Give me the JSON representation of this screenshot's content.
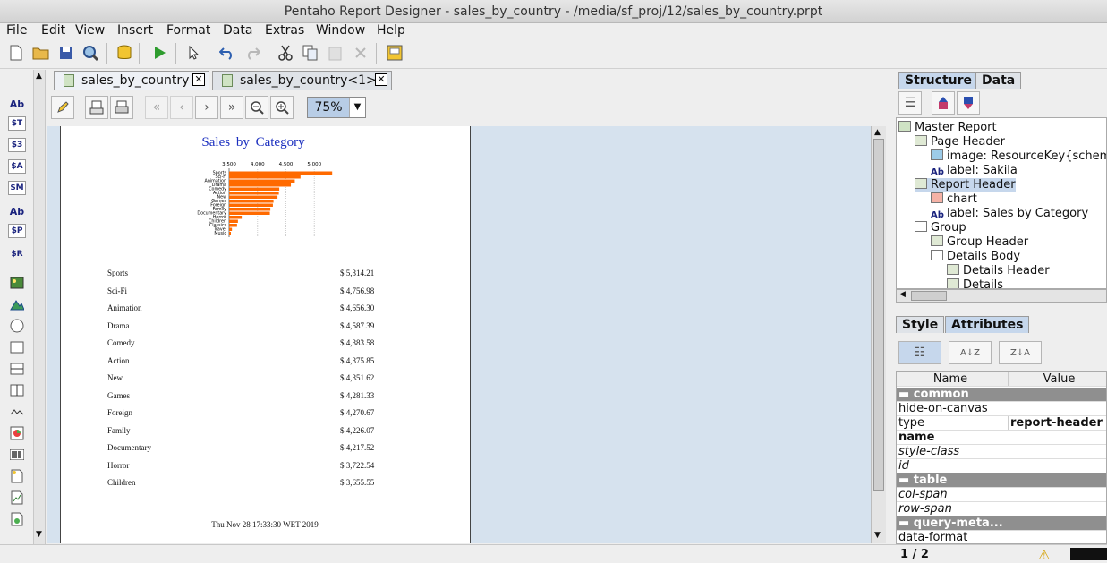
{
  "window": {
    "title": "Pentaho Report Designer - sales_by_country - /media/sf_proj/12/sales_by_country.prpt"
  },
  "menu": [
    "File",
    "Edit",
    "View",
    "Insert",
    "Format",
    "Data",
    "Extras",
    "Window",
    "Help"
  ],
  "toolbar_icons": [
    "new-icon",
    "open-icon",
    "save-icon",
    "preview-icon",
    "database-icon",
    "run-icon",
    "select-icon",
    "undo-icon",
    "redo-icon",
    "cut-icon",
    "copy-icon",
    "paste-icon",
    "delete-icon",
    "publish-icon"
  ],
  "palette_labels": [
    "Ab",
    "$T",
    "$3",
    "$A",
    "$M",
    "Ab",
    "$P",
    "$R"
  ],
  "tabs": [
    {
      "label": "sales_by_country"
    },
    {
      "label": "sales_by_country<1>"
    }
  ],
  "zoom": {
    "value": "75%"
  },
  "report": {
    "title": "Sales by Category",
    "chart_data": {
      "type": "bar",
      "orientation": "horizontal",
      "categories": [
        "Sports",
        "Sci-Fi",
        "Animation",
        "Drama",
        "Comedy",
        "Action",
        "New",
        "Games",
        "Foreign",
        "Family",
        "Documentary",
        "Horror",
        "Children",
        "Classics",
        "Travel",
        "Music"
      ],
      "values": [
        5314.21,
        4756.98,
        4656.3,
        4587.39,
        4383.58,
        4375.85,
        4351.62,
        4281.33,
        4270.67,
        4226.07,
        4217.52,
        3722.54,
        3655.55,
        3639.59,
        3549.64,
        3417.72
      ],
      "ticks": [
        "3.500",
        "4.000",
        "4.500",
        "5.000"
      ],
      "xlim": [
        3500,
        5500
      ],
      "color": "#ff6a00",
      "grid": true
    },
    "rows": [
      {
        "category": "Sports",
        "amount": "$ 5,314.21"
      },
      {
        "category": "Sci-Fi",
        "amount": "$ 4,756.98"
      },
      {
        "category": "Animation",
        "amount": "$ 4,656.30"
      },
      {
        "category": "Drama",
        "amount": "$ 4,587.39"
      },
      {
        "category": "Comedy",
        "amount": "$ 4,383.58"
      },
      {
        "category": "Action",
        "amount": "$ 4,375.85"
      },
      {
        "category": "New",
        "amount": "$ 4,351.62"
      },
      {
        "category": "Games",
        "amount": "$ 4,281.33"
      },
      {
        "category": "Foreign",
        "amount": "$ 4,270.67"
      },
      {
        "category": "Family",
        "amount": "$ 4,226.07"
      },
      {
        "category": "Documentary",
        "amount": "$ 4,217.52"
      },
      {
        "category": "Horror",
        "amount": "$ 3,722.54"
      },
      {
        "category": "Children",
        "amount": "$ 3,655.55"
      }
    ],
    "footer": "Thu Nov 28 17:33:30 WET 2019"
  },
  "structure_tabs": [
    "Structure",
    "Data"
  ],
  "tree": [
    {
      "label": "Master Report",
      "icon": "report-icon",
      "selected": false
    },
    {
      "label": "Page Header",
      "icon": "band-icon",
      "selected": false
    },
    {
      "label": "image: ResourceKey{schema",
      "icon": "image-icon",
      "selected": false
    },
    {
      "label": "label: Sakila",
      "icon": "label-icon",
      "selected": false
    },
    {
      "label": "Report Header",
      "icon": "band-icon",
      "selected": true
    },
    {
      "label": "chart",
      "icon": "chart-icon",
      "selected": false
    },
    {
      "label": "label: Sales by Category",
      "icon": "label-icon",
      "selected": false
    },
    {
      "label": "Group",
      "icon": "group-icon",
      "selected": false
    },
    {
      "label": "Group Header",
      "icon": "band-icon",
      "selected": false
    },
    {
      "label": "Details Body",
      "icon": "group-icon",
      "selected": false
    },
    {
      "label": "Details Header",
      "icon": "band-icon",
      "selected": false
    },
    {
      "label": "Details",
      "icon": "band-icon",
      "selected": false
    }
  ],
  "attr_tabs": [
    "Style",
    "Attributes"
  ],
  "attr_headers": {
    "name": "Name",
    "value": "Value"
  },
  "attributes": [
    {
      "name": "common",
      "value": "",
      "type": "group"
    },
    {
      "name": "hide-on-canvas",
      "value": "",
      "type": "normal"
    },
    {
      "name": "type",
      "value": "report-header",
      "type": "normal"
    },
    {
      "name": "name",
      "value": "",
      "type": "bold"
    },
    {
      "name": "style-class",
      "value": "",
      "type": "italic"
    },
    {
      "name": "id",
      "value": "",
      "type": "italic"
    },
    {
      "name": "table",
      "value": "",
      "type": "group"
    },
    {
      "name": "col-span",
      "value": "",
      "type": "italic"
    },
    {
      "name": "row-span",
      "value": "",
      "type": "italic"
    },
    {
      "name": "query-meta...",
      "value": "",
      "type": "group"
    },
    {
      "name": "data-format",
      "value": "",
      "type": "normal"
    }
  ],
  "status": {
    "page": "1 / 2"
  }
}
